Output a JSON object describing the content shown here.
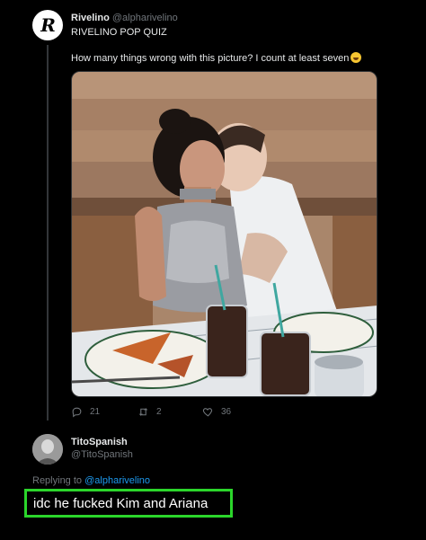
{
  "tweet": {
    "avatar_letter": "R",
    "author_name": "Rivelino",
    "author_handle": "@alpharivelino",
    "line2": "RIVELINO POP QUIZ",
    "body": "How many things wrong with this picture? I count at least seven",
    "emoji_icon": "grinning-sweat-emoji",
    "replies": "21",
    "retweets": "2",
    "likes": "36"
  },
  "reply": {
    "author_name": "TitoSpanish",
    "author_handle": "@TitoSpanish",
    "replying_prefix": "Replying to",
    "replying_to": "@alpharivelino",
    "text": "idc he fucked Kim and Ariana",
    "highlight_color": "#2bd62b"
  },
  "colors": {
    "background": "#000000",
    "text": "#e7e9ea",
    "muted": "#71767b",
    "link": "#1d9bf0"
  }
}
